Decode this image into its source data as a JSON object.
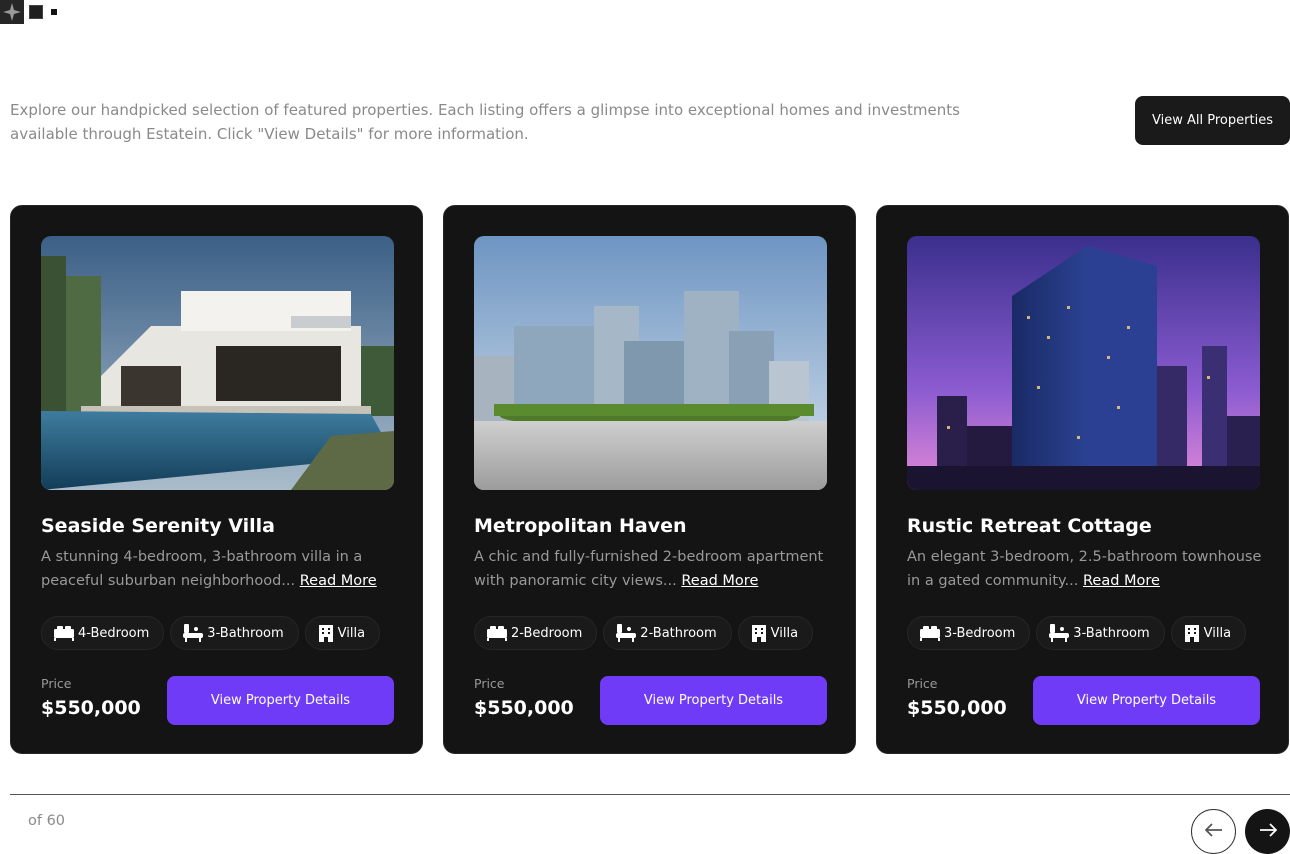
{
  "intro": {
    "text": "Explore our handpicked selection of featured properties. Each listing offers a glimpse into exceptional homes and investments available through Estatein. Click \"View Details\" for more information.",
    "view_all_label": "View All Properties"
  },
  "cards": [
    {
      "title": "Seaside Serenity Villa",
      "desc": "A stunning 4-bedroom, 3-bathroom villa in a peaceful suburban neighborhood...",
      "more": "Read More",
      "chips": [
        "4-Bedroom",
        "3-Bathroom",
        "Villa"
      ],
      "price_label": "Price",
      "price": "$550,000",
      "button": "View Property Details"
    },
    {
      "title": "Metropolitan Haven",
      "desc": "A chic and fully-furnished 2-bedroom apartment with panoramic city views...",
      "more": "Read More",
      "chips": [
        "2-Bedroom",
        "2-Bathroom",
        "Villa"
      ],
      "price_label": "Price",
      "price": "$550,000",
      "button": "View Property Details"
    },
    {
      "title": "Rustic Retreat Cottage",
      "desc": "An elegant 3-bedroom, 2.5-bathroom townhouse in a gated community...",
      "more": "Read More",
      "chips": [
        "3-Bedroom",
        "3-Bathroom",
        "Villa"
      ],
      "price_label": "Price",
      "price": "$550,000",
      "button": "View Property Details"
    }
  ],
  "pager": {
    "text": "of 60"
  },
  "colors": {
    "accent": "#703bf7",
    "card_bg": "#141414",
    "text_muted": "#999999"
  },
  "icons": [
    "sparkle-icon",
    "bed-icon",
    "bath-icon",
    "building-icon",
    "arrow-left-icon",
    "arrow-right-icon"
  ]
}
